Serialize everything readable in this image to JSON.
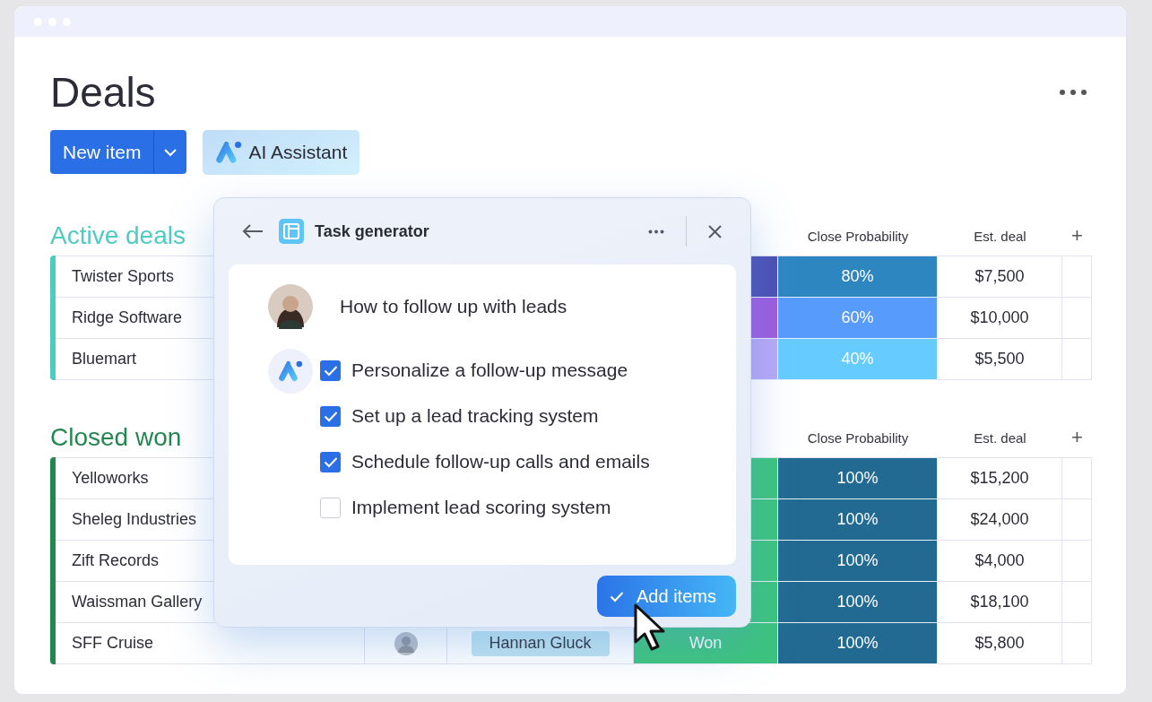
{
  "page": {
    "title": "Deals",
    "new_item_button": "New item",
    "ai_button": "AI Assistant"
  },
  "groups": [
    {
      "title": "Active deals",
      "color": "#4fcbc0",
      "columns": [
        "Close Probability",
        "Est. deal"
      ],
      "add_column": "+",
      "rows": [
        {
          "name": "Twister Sports",
          "status": {
            "color": "#4c4fb3"
          },
          "probability": {
            "label": "80%",
            "color": "#2e86c1"
          },
          "est_deal": "$7,500"
        },
        {
          "name": "Ridge Software",
          "status": {
            "color": "#9d5be0"
          },
          "probability": {
            "label": "60%",
            "color": "#579bfc"
          },
          "est_deal": "$10,000"
        },
        {
          "name": "Bluemart",
          "status": {
            "color": "#b7a8f7"
          },
          "probability": {
            "label": "40%",
            "color": "#66ccff"
          },
          "est_deal": "$5,500"
        }
      ]
    },
    {
      "title": "Closed won",
      "color": "#258750",
      "columns": [
        "Close Probability",
        "Est. deal"
      ],
      "add_column": "+",
      "rows": [
        {
          "name": "Yelloworks",
          "status": {
            "color": "#3cc47c"
          },
          "probability": {
            "label": "100%",
            "color": "#236a93"
          },
          "est_deal": "$15,200"
        },
        {
          "name": "Sheleg Industries",
          "status": {
            "color": "#3cc47c"
          },
          "probability": {
            "label": "100%",
            "color": "#236a93"
          },
          "est_deal": "$24,000"
        },
        {
          "name": "Zift Records",
          "status": {
            "color": "#3cc47c"
          },
          "probability": {
            "label": "100%",
            "color": "#236a93"
          },
          "est_deal": "$4,000"
        },
        {
          "name": "Waissman Gallery",
          "status": {
            "color": "#3cc47c"
          },
          "probability": {
            "label": "100%",
            "color": "#236a93"
          },
          "est_deal": "$18,100"
        },
        {
          "name": "SFF Cruise",
          "person": {
            "kind": "avatar"
          },
          "owner": "Hannan Gluck",
          "status": {
            "color": "#3cc47c",
            "label": "Won"
          },
          "probability": {
            "label": "100%",
            "color": "#236a93"
          },
          "est_deal": "$5,800"
        }
      ]
    }
  ],
  "task_generator": {
    "title": "Task generator",
    "prompt": "How to follow up with leads",
    "tasks": [
      {
        "label": "Personalize a follow-up message",
        "checked": true
      },
      {
        "label": "Set up a lead tracking system",
        "checked": true
      },
      {
        "label": "Schedule follow-up calls and emails",
        "checked": true
      },
      {
        "label": "Implement lead scoring system",
        "checked": false
      }
    ],
    "add_button": "Add items"
  }
}
